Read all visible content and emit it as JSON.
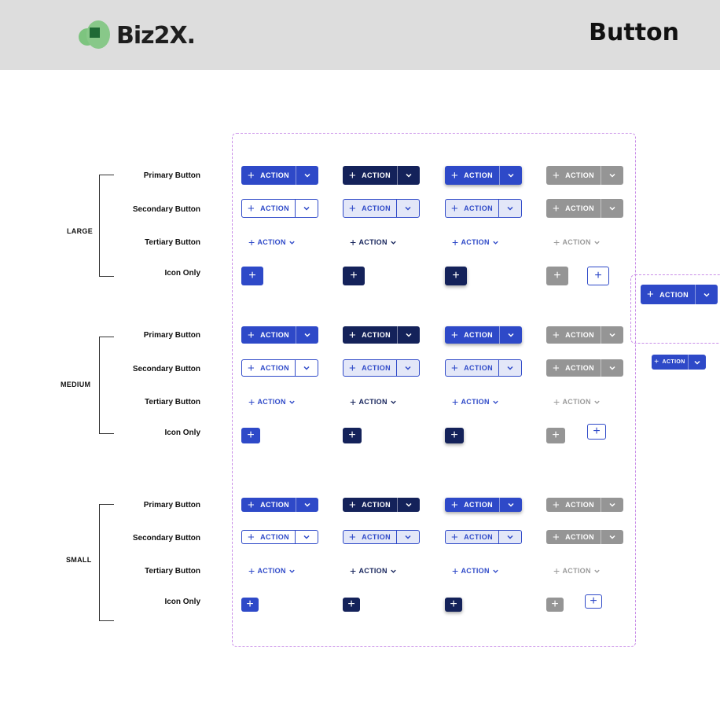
{
  "header": {
    "logo_text": "Biz2X.",
    "title": "Button"
  },
  "sizes": [
    "LARGE",
    "MEDIUM",
    "SMALL"
  ],
  "rows": {
    "primary": "Primary Button",
    "secondary": "Secondary Button",
    "tertiary": "Tertiary Button",
    "icon_only": "Icon Only"
  },
  "button": {
    "label": "ACTION",
    "plus_icon": "+"
  },
  "colors": {
    "primary_blue": "#2e49c8",
    "navy": "#14225a",
    "disabled_gray": "#959595",
    "light_blue_fill": "#e3e7f8",
    "frame_dashed": "#c98ee8",
    "header_bg": "#dddddd",
    "logo_green": "#1f6a35"
  },
  "states": [
    "default",
    "pressed",
    "hover",
    "disabled"
  ],
  "icons": {
    "plus": "plus-icon",
    "dropdown": "chevron-down-icon"
  }
}
